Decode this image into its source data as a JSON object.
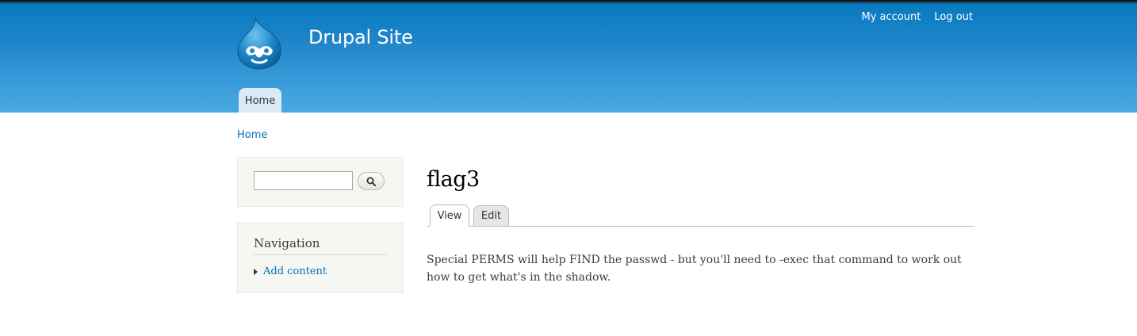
{
  "header": {
    "site_name": "Drupal Site",
    "logo_icon": "drupal-drop-icon",
    "secondary_menu": [
      {
        "label": "My account"
      },
      {
        "label": "Log out"
      }
    ],
    "main_menu": [
      {
        "label": "Home",
        "active": true
      }
    ]
  },
  "breadcrumb": {
    "items": [
      {
        "label": "Home"
      }
    ]
  },
  "sidebar": {
    "search": {
      "value": "",
      "button_icon": "search-icon"
    },
    "navigation": {
      "title": "Navigation",
      "items": [
        {
          "label": "Add content"
        }
      ]
    }
  },
  "content": {
    "title": "flag3",
    "tabs": [
      {
        "label": "View",
        "active": true
      },
      {
        "label": "Edit",
        "active": false
      }
    ],
    "body": "Special PERMS will help FIND the passwd - but you'll need to -exec that command to work out how to get what's in the shadow."
  },
  "colors": {
    "header_top": "#0779bf",
    "header_bottom": "#4aa7e1",
    "link": "#0071b3",
    "sidebar_bg": "#f6f6f2"
  }
}
